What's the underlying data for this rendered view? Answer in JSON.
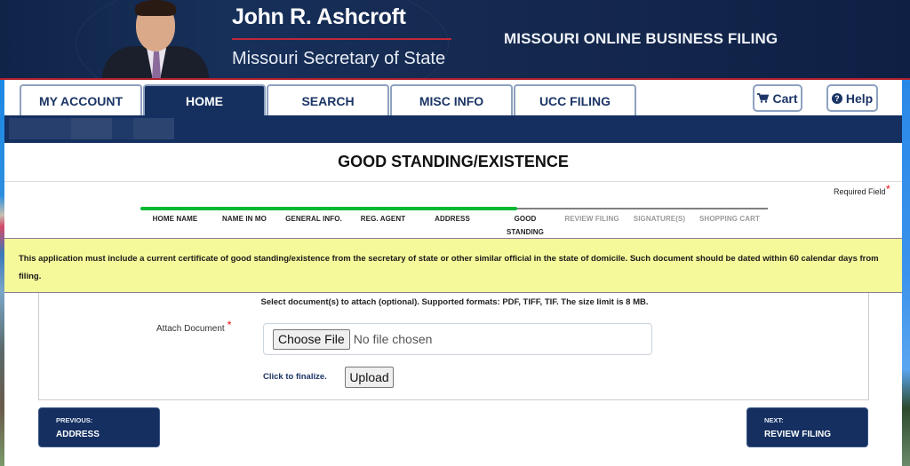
{
  "header": {
    "official_name": "John R. Ashcroft",
    "official_title": "Missouri Secretary of State",
    "site_title": "MISSOURI ONLINE BUSINESS FILING"
  },
  "tabs": [
    {
      "label": "MY ACCOUNT",
      "active": false
    },
    {
      "label": "HOME",
      "active": true
    },
    {
      "label": "SEARCH",
      "active": false
    },
    {
      "label": "MISC INFO",
      "active": false
    },
    {
      "label": "UCC FILING",
      "active": false
    }
  ],
  "toolbar": {
    "cart_label": "Cart",
    "cart_icon": "shopping-cart-icon",
    "help_label": "Help",
    "help_icon": "question-circle-icon"
  },
  "page": {
    "title": "GOOD STANDING/EXISTENCE",
    "required_label": "Required Field",
    "required_marker": "*"
  },
  "progress": {
    "completed_fraction": 0.6,
    "steps": [
      {
        "label": "HOME NAME",
        "done": true
      },
      {
        "label": "NAME IN MO",
        "done": true
      },
      {
        "label": "GENERAL INFO.",
        "done": true
      },
      {
        "label": "REG. AGENT",
        "done": true
      },
      {
        "label": "ADDRESS",
        "done": true
      },
      {
        "label": "GOOD STANDING",
        "done": true,
        "current": true
      },
      {
        "label": "REVIEW FILING",
        "done": false
      },
      {
        "label": "SIGNATURE(S)",
        "done": false
      },
      {
        "label": "SHOPPING CART",
        "done": false
      }
    ],
    "done_color": "#00b832",
    "todo_color": "#808080"
  },
  "notice": {
    "text": "This application must include a current certificate of good standing/existence from the secretary of state or other similar official in the state of domicile. Such document should be dated within 60 calendar days from filing."
  },
  "upload": {
    "hint": "Select document(s) to attach (optional). Supported formats: PDF, TIFF, TIF. The size limit is 8 MB.",
    "field_label": "Attach Document",
    "required_marker": "*",
    "choose_label": "Choose File",
    "file_status": "No file chosen",
    "finalize_label": "Click to finalize.",
    "upload_label": "Upload"
  },
  "navigation": {
    "previous_caption": "PREVIOUS:",
    "previous_label": "ADDRESS",
    "next_caption": "NEXT:",
    "next_label": "REVIEW FILING"
  },
  "colors": {
    "brand_navy": "#142f60",
    "notice_bg": "#f6f99a",
    "accent_red": "#b3202c"
  }
}
